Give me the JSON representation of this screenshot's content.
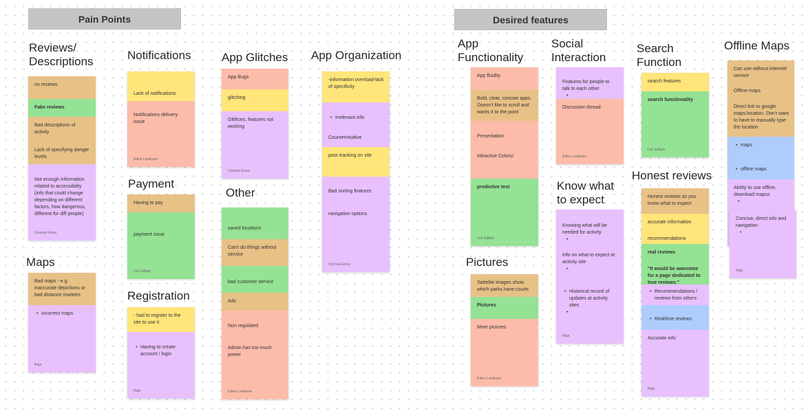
{
  "sections": {
    "pain_points": "Pain Points",
    "desired_features": "Desired features"
  },
  "colors": {
    "orange": "#e8c187",
    "green": "#94e294",
    "pink": "#fdbcaa",
    "purple": "#e8c0fd",
    "yellow": "#ffe57a",
    "blue": "#aecdfd",
    "section_header": "#c4c4c4"
  },
  "groups": {
    "reviews": {
      "title": "Reviews/\nDescriptions",
      "items": [
        "no reviews",
        "Fake reviews",
        "Bad descriptions of activity",
        "Lack of specifying danger levels",
        "Not enough information related to accessibility (info that could change depending on different factors, how dangerous, different for diff people)"
      ],
      "author": "Corinna Gross"
    },
    "notifications": {
      "title": "Notifications",
      "items": [
        "Lack of notifications",
        "Notifications delivery issue"
      ],
      "author": "Edine Landoure"
    },
    "payment": {
      "title": "Payment",
      "items": [
        "Having to pay",
        "payment issue"
      ],
      "author": "Lee Gilliam"
    },
    "maps": {
      "title": "Maps",
      "items": [
        "Bad maps - e.g. inaccurate depictions or bad distance markers",
        "Incorrect maps"
      ],
      "author": "Raja"
    },
    "registration": {
      "title": "Registration",
      "items": [
        "- had to register to the site to use it",
        "Having to create account / login"
      ],
      "author": "Raja"
    },
    "app_glitches": {
      "title": "App Glitches",
      "items": [
        "App Bugs",
        "glitching",
        "Glithces, features not working"
      ],
      "author": "Corinna Gross"
    },
    "other": {
      "title": "Other",
      "items": [
        "saved locations",
        "Can't do things without service",
        "bad customer service",
        "Ads",
        "Non regulated",
        "Admin has too much power"
      ],
      "author": "Edine Landoure"
    },
    "app_organization": {
      "title": "App Organization",
      "items": [
        "-information overload-lack of specificity",
        "Irrelevant info",
        "Counterintuitive",
        "poor tracking on site",
        "Bad sorting features",
        "navigation options"
      ],
      "author": "Corinna Gross"
    },
    "app_functionality": {
      "title": "App\nFunctionality",
      "items": [
        "App fluidity",
        "Bold, clear, concise apps. Doesn't like to scroll and wants it to the point",
        "Presentation",
        "Attractive Colors/",
        "predictive text"
      ],
      "author": "Lee Gilliam"
    },
    "social_interaction": {
      "title": "Social\nInteraction",
      "items": [
        "Features for people to talk to each other",
        "Discussion thread"
      ],
      "author": "Edine Landoure"
    },
    "know_what_to_expect": {
      "title": "Know what\n to expect",
      "items": [
        "Knowing what will be needed for activity",
        "Info on what to expect at activity site",
        "Historical record of updates at activity sites"
      ],
      "author": "Raja"
    },
    "pictures": {
      "title": "Pictures",
      "items": [
        "Sattelite images show which parks have courts",
        "Pictures",
        "More pictures"
      ],
      "author": "Edine Landoure"
    },
    "search_function": {
      "title": "Search\nFunction",
      "items": [
        "search features",
        "search functinoality"
      ],
      "author": "Lee Gilliam"
    },
    "honest_reviews": {
      "title": "Honest reviews",
      "items": [
        "Honest reviews so you know what to expect",
        "accurate information",
        "recommendations",
        "real reviews",
        "\"It would be awesome for a page dedicated to true reviews.\"",
        "Recommendations / reviews from others",
        "Real/true reviews",
        "Accurate info"
      ],
      "author": "Raja"
    },
    "offline_maps": {
      "title": "Offline Maps",
      "items": [
        "Can use without internet/ service",
        "Offline maps",
        "Direct link to google maps.location. Don't want to have to manually type the location",
        "maps",
        "offline maps",
        "Ability to use offline, download mapss",
        "Concise, direct info and navigation"
      ],
      "author": "Raja"
    }
  }
}
